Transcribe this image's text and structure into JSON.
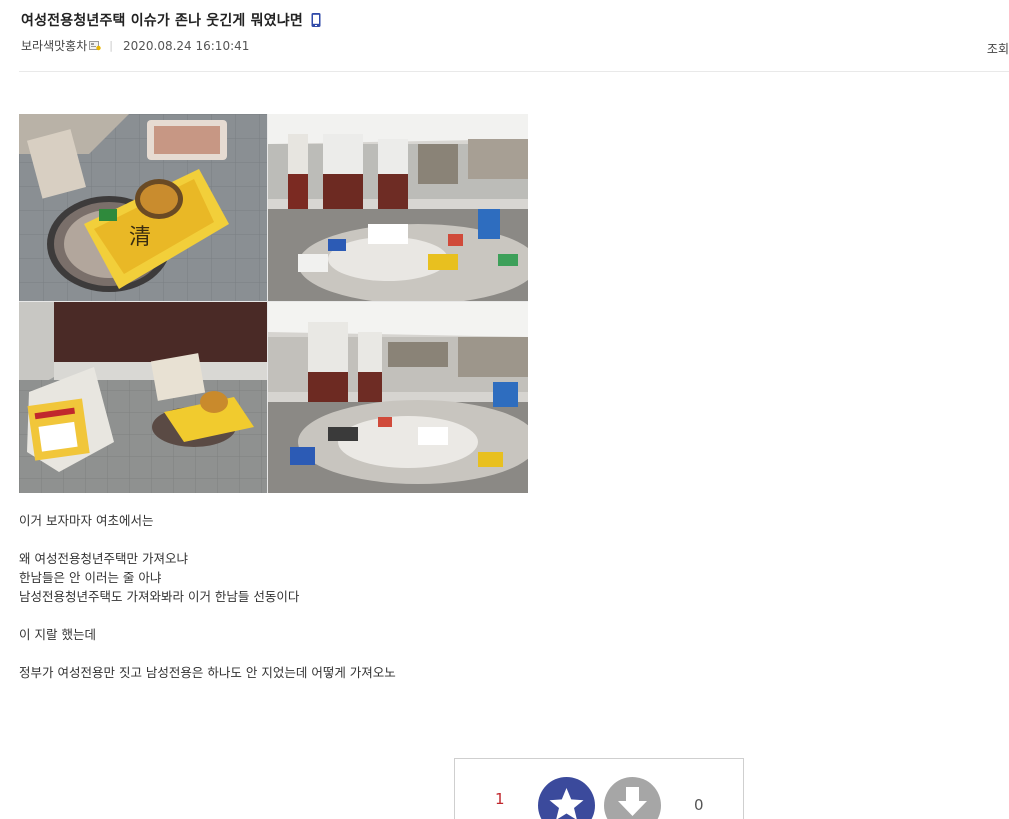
{
  "post": {
    "title": "여성전용청년주택 이슈가 존나 웃긴게 뭐였냐면",
    "author": "보라색맛홍차",
    "date": "2020.08.24 16:10:41",
    "views_label": "조회",
    "mobile_icon": "mobile-phone-icon",
    "level_icon": "member-level-icon"
  },
  "photos": [
    {
      "name": "photo-food-package",
      "description_icon": "photo"
    },
    {
      "name": "photo-trash-pile-1",
      "description_icon": "photo"
    },
    {
      "name": "photo-rice-bag",
      "description_icon": "photo"
    },
    {
      "name": "photo-trash-pile-2",
      "description_icon": "photo"
    }
  ],
  "body": {
    "lines": [
      "이거 보자마자 여초에서는",
      "",
      "왜 여성전용청년주택만 가져오냐",
      "한남들은 안 이러는 줄 아냐",
      "남성전용청년주택도 가져와봐라 이거 한남들 선동이다",
      "",
      "이 지랄 했는데",
      "",
      "정부가 여성전용만 짓고 남성전용은 하나도 안 지었는데 어떻게 가져오노"
    ]
  },
  "vote": {
    "up_count": "1",
    "down_count": "0",
    "up_icon": "star-icon",
    "down_icon": "arrow-down-icon",
    "up_color": "#3b4a9c",
    "down_color": "#a6a6a6",
    "up_count_color": "#c1272d"
  }
}
